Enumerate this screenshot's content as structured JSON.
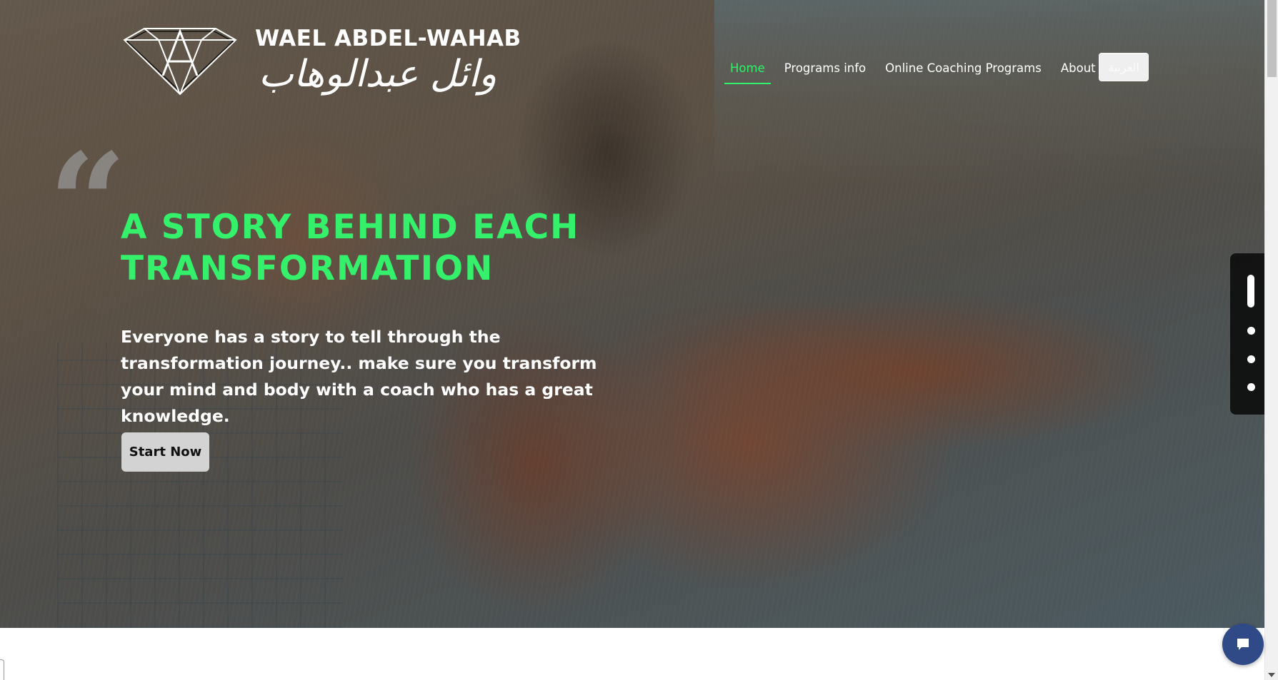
{
  "brand": {
    "name": "WAEL ABDEL-WAHAB",
    "name_arabic": "وائل عبدالوهاب"
  },
  "nav": {
    "items": [
      {
        "label": "Home",
        "active": true
      },
      {
        "label": "Programs info",
        "active": false
      },
      {
        "label": "Online Coaching Programs",
        "active": false
      },
      {
        "label": "About",
        "active": false
      }
    ],
    "language_button": "العربية"
  },
  "hero": {
    "quote_mark": "“",
    "title": "A STORY BEHIND EACH TRANSFORMATION",
    "subtitle": "Everyone has a story to tell through the transformation journey.. make sure you transform your mind and body with a coach who has a great knowledge.",
    "cta_label": "Start Now"
  },
  "slider": {
    "slide_count": 4,
    "active_index": 0
  },
  "icons": {
    "logo": "diamond-logo-icon",
    "chat": "chat-bubble-icon"
  },
  "colors": {
    "accent_green": "#34f06a",
    "cta_background": "#d3d3d3",
    "chat_button": "#2f4a86",
    "slider_panel": "#0a0a0a"
  }
}
